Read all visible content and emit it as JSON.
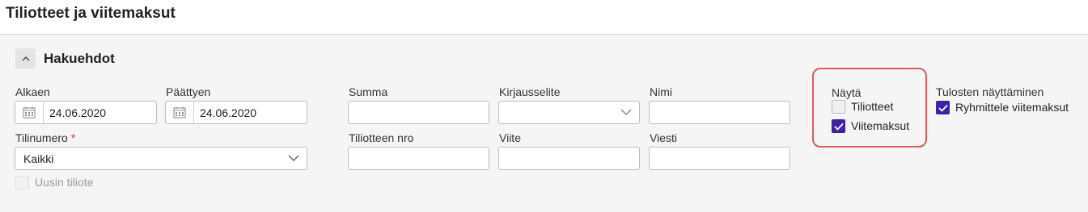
{
  "page": {
    "title": "Tiliotteet ja viitemaksut"
  },
  "section": {
    "title": "Hakuehdot",
    "toggle_icon": "chevron-up-icon"
  },
  "filters": {
    "alkaen": {
      "label": "Alkaen",
      "value": "24.06.2020",
      "icon": "calendar-icon"
    },
    "paattyen": {
      "label": "Päättyen",
      "value": "24.06.2020",
      "icon": "calendar-icon"
    },
    "tilinumero": {
      "label": "Tilinumero",
      "required_mark": "*",
      "value": "Kaikki"
    },
    "uusin_tiliote": {
      "label": "Uusin tiliote",
      "checked": false,
      "disabled": true
    },
    "summa": {
      "label": "Summa",
      "value": ""
    },
    "tiliotteen_nro": {
      "label": "Tiliotteen nro",
      "value": ""
    },
    "kirjausselite": {
      "label": "Kirjausselite",
      "value": ""
    },
    "viite": {
      "label": "Viite",
      "value": ""
    },
    "nimi": {
      "label": "Nimi",
      "value": ""
    },
    "viesti": {
      "label": "Viesti",
      "value": ""
    }
  },
  "nayta": {
    "label": "Näytä",
    "options": [
      {
        "label": "Tiliotteet",
        "checked": false
      },
      {
        "label": "Viitemaksut",
        "checked": true
      }
    ]
  },
  "tulosten_nayttaminen": {
    "label": "Tulosten näyttäminen",
    "option": {
      "label": "Ryhmittele viitemaksut",
      "checked": true
    }
  },
  "colors": {
    "accent": "#3d22a8",
    "highlight": "#e05a60",
    "required": "#d9362f"
  }
}
